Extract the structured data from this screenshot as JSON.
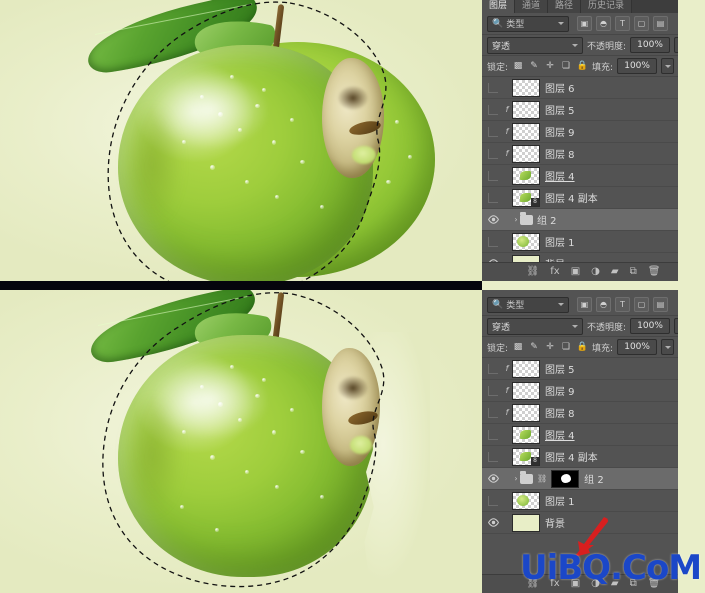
{
  "app": {
    "name": "Adobe Photoshop Layers Panel",
    "background_color": "#e9eec9",
    "panel_color": "#535353",
    "accent_selected": "#6b6b6b"
  },
  "panel": {
    "tabs": [
      {
        "label": "图层",
        "active": true
      },
      {
        "label": "通道",
        "active": false
      },
      {
        "label": "路径",
        "active": false
      },
      {
        "label": "历史记录",
        "active": false
      }
    ],
    "menu_icon": "panel-menu-icon",
    "filter": {
      "search_icon": "search-icon",
      "kind_label": "类型",
      "icons": [
        {
          "name": "filter-pixel-icon",
          "glyph": "▣"
        },
        {
          "name": "filter-adjustment-icon",
          "glyph": "◓"
        },
        {
          "name": "filter-type-icon",
          "glyph": "T"
        },
        {
          "name": "filter-shape-icon",
          "glyph": "▢"
        },
        {
          "name": "filter-smart-object-icon",
          "glyph": "▤"
        }
      ],
      "toggle_name": "filter-enable-toggle"
    },
    "blend": {
      "mode_label": "穿透",
      "opacity_label": "不透明度:",
      "opacity_value": "100%"
    },
    "lock": {
      "label": "锁定:",
      "icons": [
        {
          "name": "lock-transparent-pixels-icon",
          "glyph": "▩"
        },
        {
          "name": "lock-image-pixels-icon",
          "glyph": "✎"
        },
        {
          "name": "lock-position-icon",
          "glyph": "✛"
        },
        {
          "name": "lock-artboard-nesting-icon",
          "glyph": "❏"
        },
        {
          "name": "lock-all-icon",
          "glyph": "🔒"
        }
      ],
      "fill_label": "填充:",
      "fill_value": "100%"
    },
    "bottom_toolbar": [
      {
        "name": "link-layers-icon",
        "glyph": "⛓"
      },
      {
        "name": "layer-style-fx-icon",
        "glyph": "fx"
      },
      {
        "name": "add-layer-mask-icon",
        "glyph": "▣"
      },
      {
        "name": "new-adjustment-layer-icon",
        "glyph": "◑"
      },
      {
        "name": "new-group-icon",
        "glyph": "▰"
      },
      {
        "name": "new-layer-icon",
        "glyph": "⧉"
      },
      {
        "name": "delete-layer-icon",
        "glyph": "🗑"
      }
    ]
  },
  "layers_top": [
    {
      "name": "图层 6",
      "visible": false,
      "selected": false,
      "locked": false,
      "has_fx": false,
      "type": "pixel",
      "kind": "transparent"
    },
    {
      "name": "图层 5",
      "visible": false,
      "selected": false,
      "locked": false,
      "has_fx": true,
      "type": "pixel",
      "kind": "transparent"
    },
    {
      "name": "图层 9",
      "visible": false,
      "selected": false,
      "locked": false,
      "has_fx": true,
      "type": "pixel",
      "kind": "transparent"
    },
    {
      "name": "图层 8",
      "visible": false,
      "selected": false,
      "locked": false,
      "has_fx": true,
      "type": "pixel",
      "kind": "transparent"
    },
    {
      "name": "图层 4",
      "visible": false,
      "selected": false,
      "locked": true,
      "has_fx": false,
      "type": "pixel",
      "kind": "leaf",
      "underline": true
    },
    {
      "name": "图层 4 副本",
      "visible": false,
      "selected": false,
      "locked": false,
      "has_fx": false,
      "type": "pixel",
      "kind": "leaf",
      "badge": "8"
    },
    {
      "name": "组 2",
      "visible": true,
      "selected": true,
      "locked": false,
      "has_fx": false,
      "type": "group",
      "expanded": false
    },
    {
      "name": "图层 1",
      "visible": false,
      "selected": false,
      "locked": false,
      "has_fx": false,
      "type": "pixel",
      "kind": "apple"
    },
    {
      "name": "背景",
      "visible": true,
      "selected": false,
      "locked": true,
      "has_fx": false,
      "type": "pixel",
      "kind": "solid"
    }
  ],
  "layers_bottom": [
    {
      "name": "图层 5",
      "visible": false,
      "selected": false,
      "locked": false,
      "has_fx": true,
      "type": "pixel",
      "kind": "transparent"
    },
    {
      "name": "图层 9",
      "visible": false,
      "selected": false,
      "locked": false,
      "has_fx": true,
      "type": "pixel",
      "kind": "transparent"
    },
    {
      "name": "图层 8",
      "visible": false,
      "selected": false,
      "locked": false,
      "has_fx": true,
      "type": "pixel",
      "kind": "transparent"
    },
    {
      "name": "图层 4",
      "visible": false,
      "selected": false,
      "locked": true,
      "has_fx": false,
      "type": "pixel",
      "kind": "leaf",
      "underline": true
    },
    {
      "name": "图层 4 副本",
      "visible": false,
      "selected": false,
      "locked": false,
      "has_fx": false,
      "type": "pixel",
      "kind": "leaf",
      "badge": "8"
    },
    {
      "name": "组 2",
      "visible": true,
      "selected": true,
      "locked": false,
      "has_fx": false,
      "type": "group-masked",
      "expanded": false,
      "mask": "layer-mask-black-with-white-shape"
    },
    {
      "name": "图层 1",
      "visible": false,
      "selected": false,
      "locked": false,
      "has_fx": false,
      "type": "pixel",
      "kind": "apple"
    },
    {
      "name": "背景",
      "visible": true,
      "selected": false,
      "locked": true,
      "has_fx": false,
      "type": "pixel",
      "kind": "solid"
    }
  ],
  "canvas": {
    "top": {
      "name": "canvas-before",
      "subject": "green apple with leaf, stem and a bitten profile face, full apple body still visible behind the bite",
      "selection": "elliptical marching-ants selection"
    },
    "bottom": {
      "name": "canvas-after",
      "subject": "green apple with leaf, stem and a bitten profile face, bite cut through to the background",
      "selection": "elliptical marching-ants selection"
    }
  },
  "annotations": {
    "arrow_color": "#d81f1f",
    "arrow_name": "red-pointer-arrow"
  },
  "watermark": {
    "text": "UiBQ.CoM",
    "color": "#1b47c8"
  }
}
